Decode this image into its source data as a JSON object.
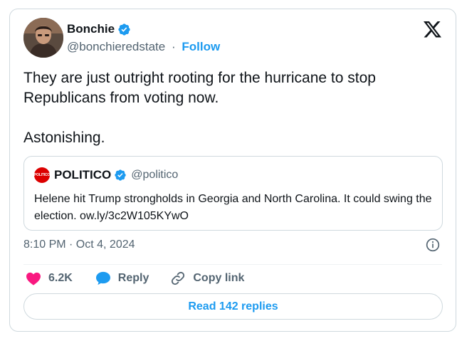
{
  "author": {
    "name": "Bonchie",
    "handle": "@bonchieredstate",
    "separator": "·",
    "follow_label": "Follow"
  },
  "tweet": {
    "paragraphs": [
      "They are just outright rooting for the hurricane to stop Republicans from voting now.",
      "Astonishing."
    ]
  },
  "quoted": {
    "logo_text": "POLITICO",
    "name": "POLITICO",
    "handle": "@politico",
    "text": "Helene hit Trump strongholds in Georgia and North Carolina. It could swing the election. ow.ly/3c2W105KYwO"
  },
  "meta": {
    "timestamp": "8:10 PM · Oct 4, 2024"
  },
  "actions": {
    "like_count": "6.2K",
    "reply_label": "Reply",
    "copy_link_label": "Copy link"
  },
  "replies_button_label": "Read 142 replies",
  "colors": {
    "accent": "#1d9bf0",
    "like": "#f91880",
    "text": "#0f1419",
    "muted": "#536471",
    "border": "#cfd9de",
    "politico_red": "#dc0000"
  },
  "icons": {
    "verified": "verified-badge-icon",
    "x_logo": "x-logo-icon",
    "info": "info-icon",
    "like": "heart-icon",
    "reply": "speech-bubble-icon",
    "copy_link": "link-icon"
  }
}
